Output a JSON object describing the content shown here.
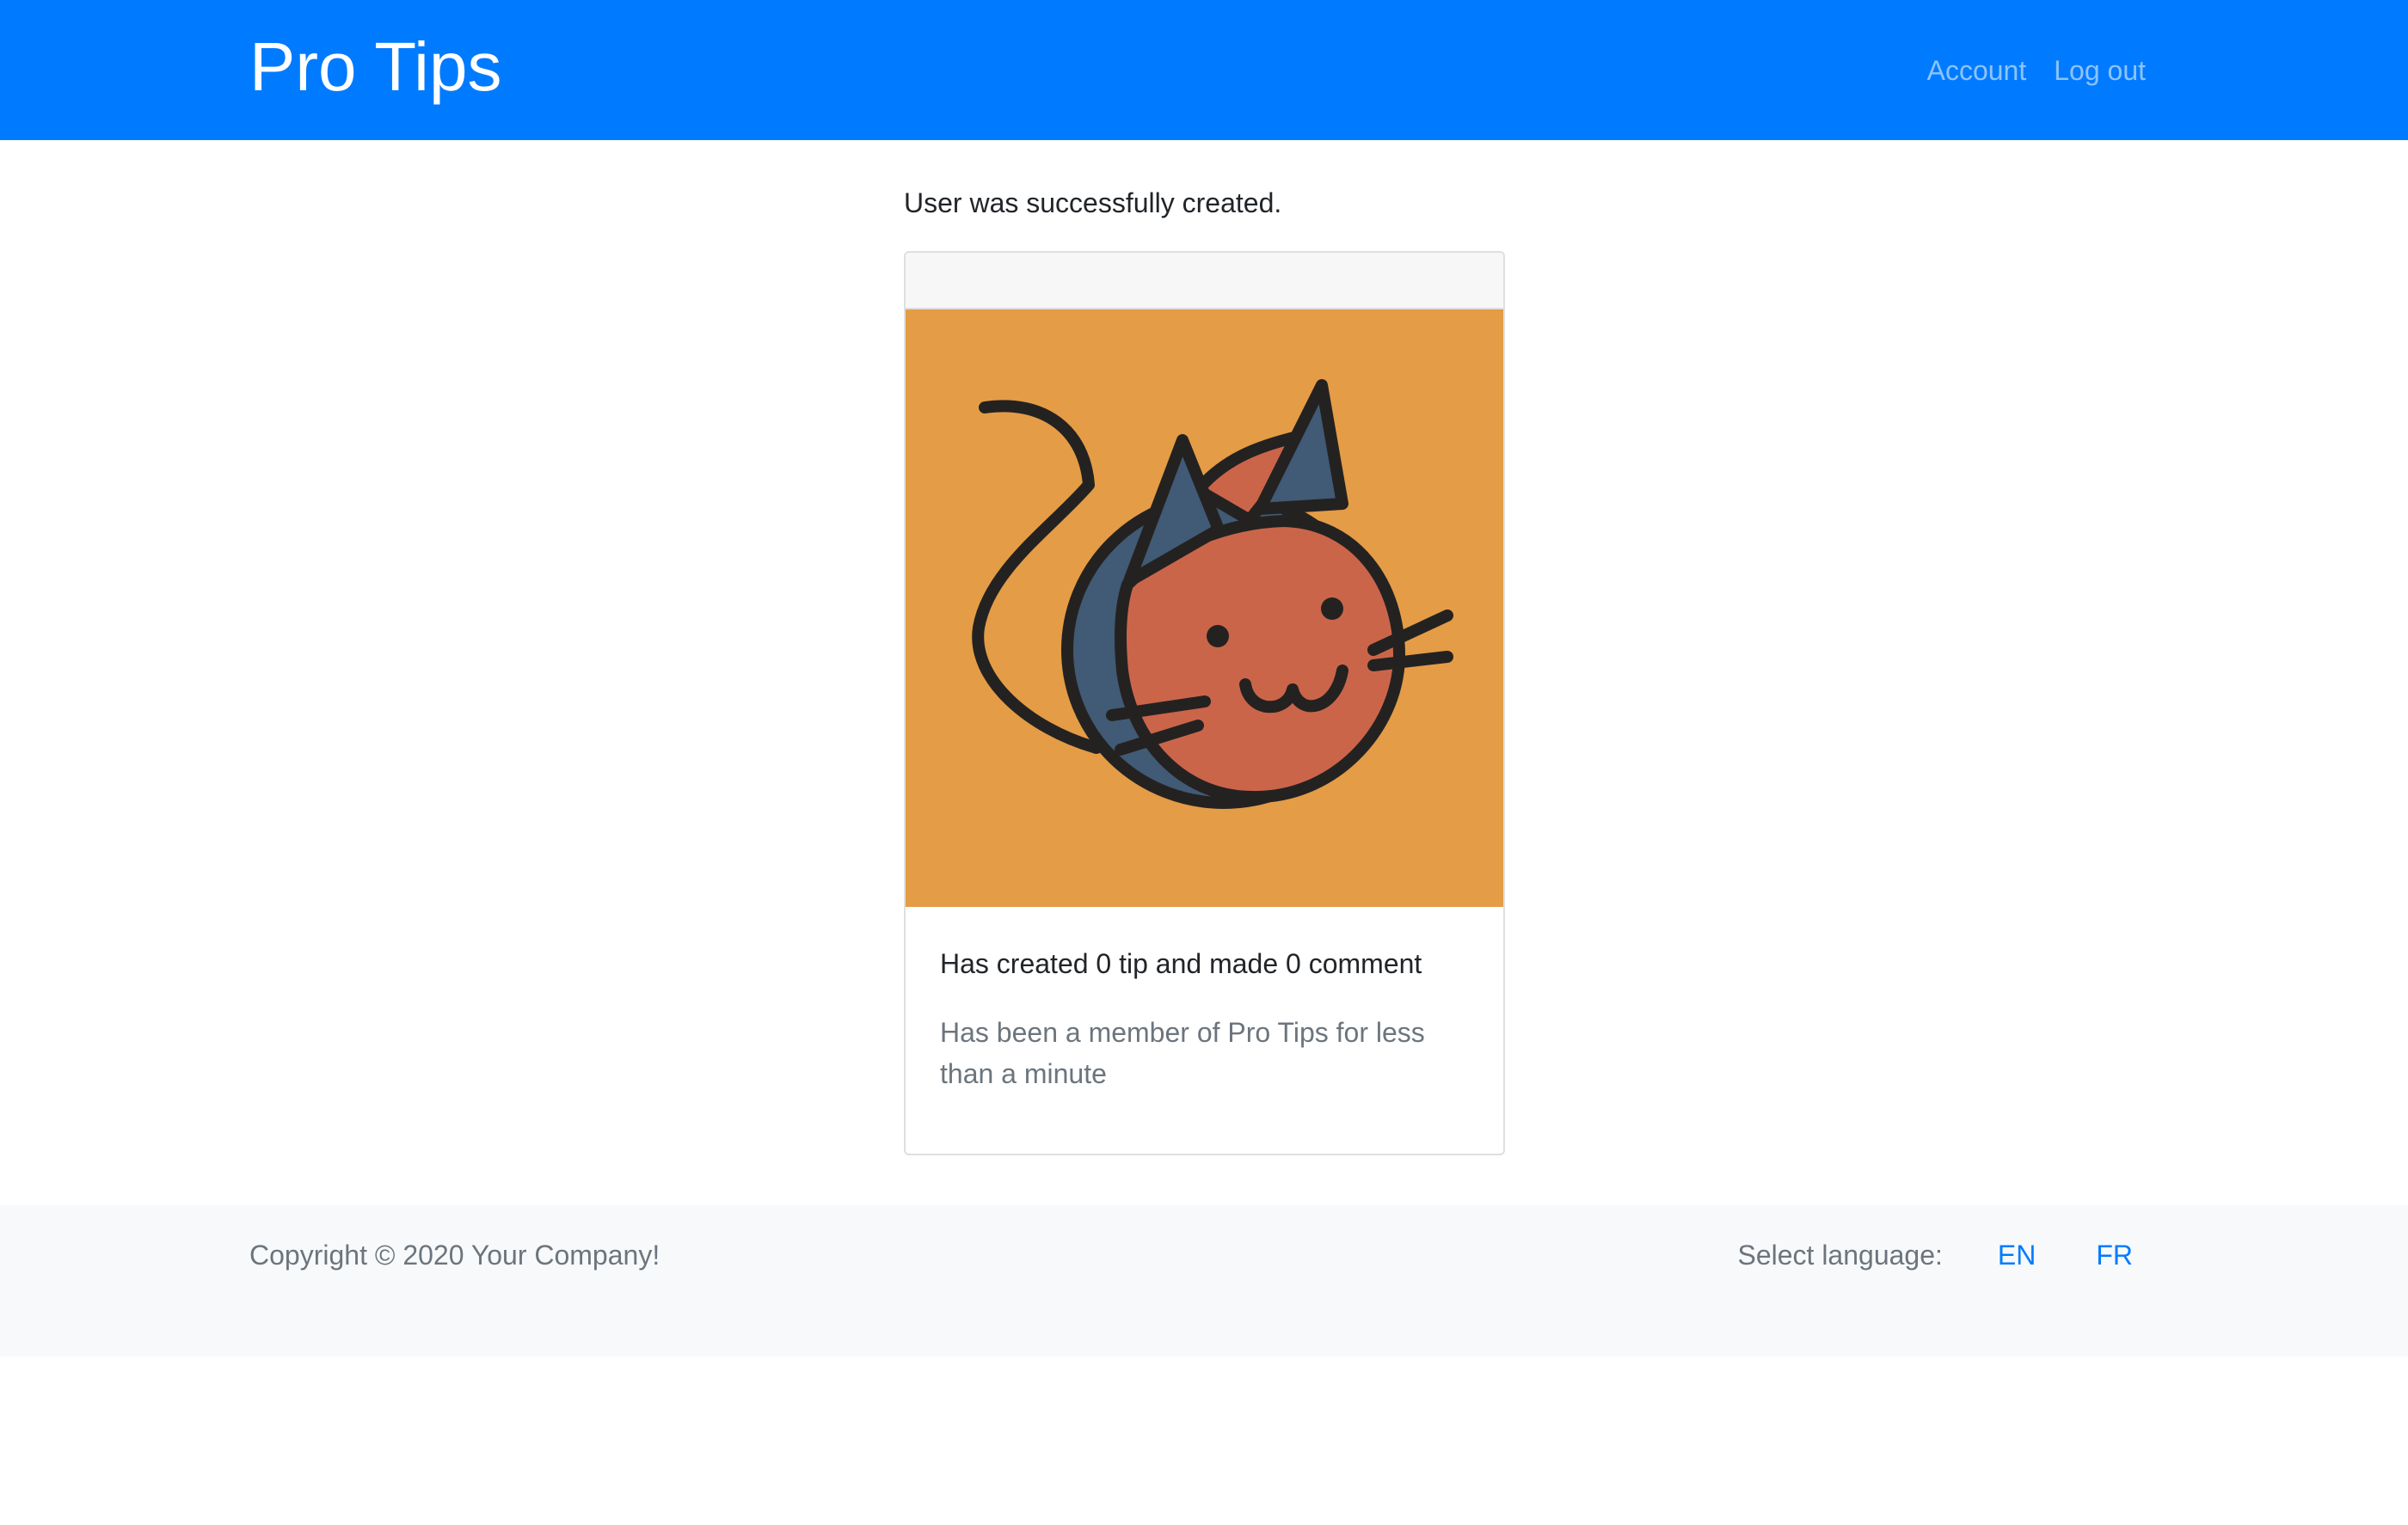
{
  "navbar": {
    "brand": "Pro Tips",
    "links": {
      "account": "Account",
      "logout": "Log out"
    }
  },
  "flash": {
    "message": "User was successfully created."
  },
  "profile_card": {
    "avatar": {
      "icon": "cat-avatar-icon",
      "background_color": "#e49c46"
    },
    "stats": "Has created 0 tip and made 0 comment",
    "membership": "Has been a member of Pro Tips for less than a minute"
  },
  "footer": {
    "copyright": "Copyright © 2020 Your Company!",
    "language": {
      "label": "Select language:",
      "options": [
        "EN",
        "FR"
      ]
    }
  },
  "colors": {
    "primary": "#007bff",
    "footer_bg": "#f8f9fa",
    "muted_text": "#6c757d"
  }
}
